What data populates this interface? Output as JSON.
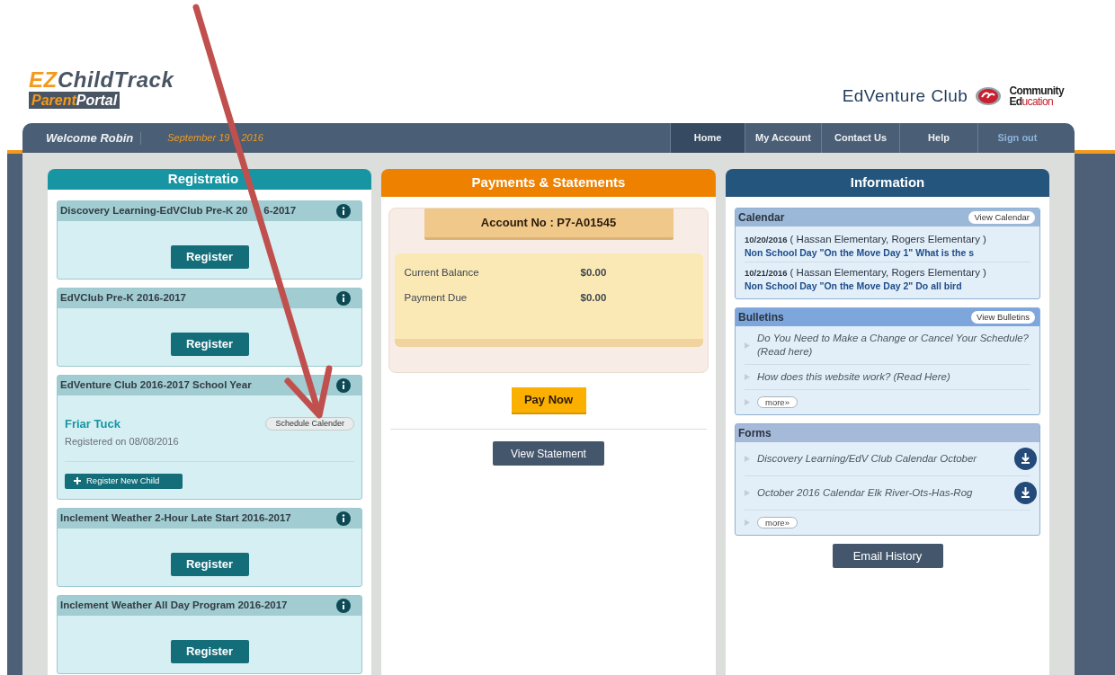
{
  "logo": {
    "primary": "EZ",
    "secondary": "ChildTrack",
    "badge_primary": "Parent",
    "badge_secondary": "Portal"
  },
  "club_name": "EdVenture Club",
  "partner_logo": {
    "line_1": "Community",
    "line_2_a": "Ed",
    "line_2_b": "ucation"
  },
  "welcome": "Welcome Robin",
  "date": [
    "September 19",
    "2016"
  ],
  "nav": [
    {
      "label": "Home",
      "selected": true,
      "kind": "link"
    },
    {
      "label": "My Account",
      "selected": false,
      "kind": "link"
    },
    {
      "label": "Contact Us",
      "selected": false,
      "kind": "link"
    },
    {
      "label": "Help",
      "selected": false,
      "kind": "link"
    },
    {
      "label": "Sign out",
      "selected": false,
      "kind": "signout"
    }
  ],
  "registration": {
    "title": "Registratio",
    "programs": [
      {
        "kind": "open",
        "title": [
          "Discovery Learning-EdVClub Pre-K 20",
          "6-2017"
        ],
        "button": "Register"
      },
      {
        "kind": "open",
        "title": [
          "EdVClub Pre-K 2016-2017"
        ],
        "button": "Register"
      },
      {
        "kind": "enrolled",
        "title": [
          "EdVenture Club 2016-2017 School Year"
        ],
        "child": "Friar Tuck",
        "schedule_button": "Schedule Calender",
        "registered": "Registered on 08/08/2016",
        "add_button": "Register New Child"
      },
      {
        "kind": "open",
        "title": [
          "Inclement Weather 2-Hour Late Start 2016-2017"
        ],
        "button": "Register"
      },
      {
        "kind": "open",
        "title": [
          "Inclement Weather All Day Program 2016-2017"
        ],
        "button": "Register"
      }
    ]
  },
  "payments": {
    "title": "Payments & Statements",
    "account": "Account No : P7-A01545",
    "rows": [
      {
        "label": "Current Balance",
        "value": "$0.00"
      },
      {
        "label": "Payment Due",
        "value": "$0.00"
      }
    ],
    "pay_button": "Pay Now",
    "statement_button": "View Statement"
  },
  "information": {
    "title": "Information",
    "calendar": {
      "title": "Calendar",
      "button": "View Calendar",
      "events": [
        {
          "date": "10/20/2016",
          "schools": "( Hassan Elementary, Rogers Elementary )",
          "title": "Non School Day \"On the Move Day 1\" What is the s"
        },
        {
          "date": "10/21/2016",
          "schools": "( Hassan Elementary, Rogers Elementary )",
          "title": "Non School Day \"On the Move Day 2\" Do all bird"
        }
      ]
    },
    "bulletins": {
      "title": "Bulletins",
      "button": "View Bulletins",
      "items": [
        "Do You Need to Make a Change or Cancel Your Schedule? (Read here)",
        "How does this website work? (Read Here)"
      ],
      "more": "more»"
    },
    "forms": {
      "title": "Forms",
      "items": [
        "Discovery Learning/EdV Club Calendar October",
        "October 2016 Calendar Elk River-Ots-Has-Rog"
      ],
      "more": "more»"
    },
    "email_button": "Email History"
  }
}
